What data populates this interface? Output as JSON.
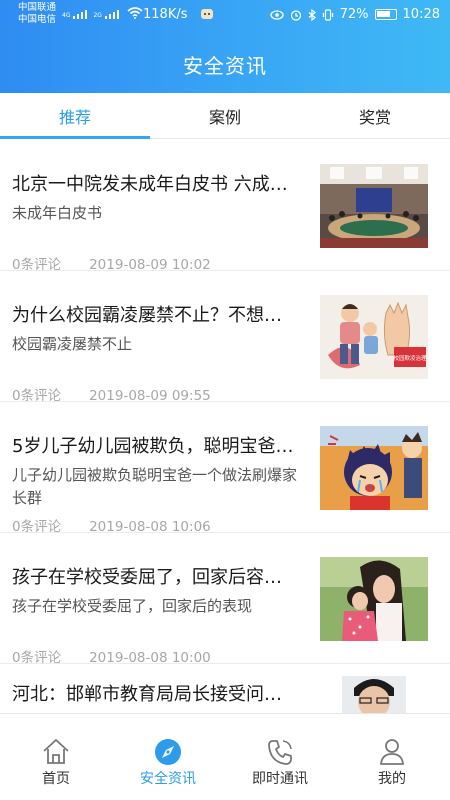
{
  "status_bar": {
    "carrier_1": "中国联通",
    "carrier_2": "中国电信",
    "net_1": "4G",
    "net_2": "2G",
    "speed": "118K/s",
    "battery": "72%",
    "time": "10:28"
  },
  "header": {
    "title": "安全资讯"
  },
  "tabs": [
    {
      "label": "推荐",
      "active": true
    },
    {
      "label": "案例",
      "active": false
    },
    {
      "label": "奖赏",
      "active": false
    }
  ],
  "articles": [
    {
      "title": "北京一中院发未成年白皮书 六成…",
      "desc": "未成年白皮书",
      "comments": "0条评论",
      "time": "2019-08-09 10:02",
      "thumb": "meeting-room-photo"
    },
    {
      "title": "为什么校园霸凌屡禁不止？不想…",
      "desc": "校园霸凌屡禁不止",
      "comments": "0条评论",
      "time": "2019-08-09 09:55",
      "thumb": "bullying-illustration",
      "thumb_text": "校园欺凌治理"
    },
    {
      "title": "5岁儿子幼儿园被欺负，聪明宝爸…",
      "desc": "儿子幼儿园被欺负聪明宝爸一个做法刷爆家长群",
      "comments": "0条评论",
      "time": "2019-08-08 10:06",
      "thumb": "crying-child-cartoon"
    },
    {
      "title": "孩子在学校受委屈了，回家后容…",
      "desc": "孩子在学校受委屈了，回家后的表现",
      "comments": "0条评论",
      "time": "2019-08-08 10:00",
      "thumb": "mother-child-photo"
    },
    {
      "title": "河北：邯郸市教育局局长接受问…",
      "desc": "",
      "comments": "",
      "time": "",
      "thumb": "official-photo"
    }
  ],
  "bottom_nav": [
    {
      "label": "首页",
      "icon": "home-icon",
      "active": false
    },
    {
      "label": "安全资讯",
      "icon": "compass-icon",
      "active": true
    },
    {
      "label": "即时通讯",
      "icon": "phone-icon",
      "active": false
    },
    {
      "label": "我的",
      "icon": "user-icon",
      "active": false
    }
  ],
  "colors": {
    "accent": "#2b9bea",
    "header_start": "#2f8cf2",
    "header_end": "#3fb9f5"
  }
}
